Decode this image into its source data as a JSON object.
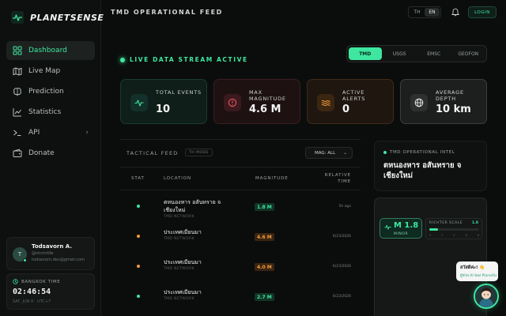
{
  "brand": {
    "name": "PLANETSENSE"
  },
  "sidebar": {
    "items": [
      {
        "label": "Dashboard",
        "icon": "dashboard-icon",
        "active": true
      },
      {
        "label": "Live Map",
        "icon": "map-icon"
      },
      {
        "label": "Prediction",
        "icon": "brain-icon"
      },
      {
        "label": "Statistics",
        "icon": "chart-icon"
      },
      {
        "label": "API",
        "icon": "terminal-icon",
        "has_children": true
      },
      {
        "label": "Donate",
        "icon": "wallet-icon"
      }
    ],
    "user": {
      "initial": "T",
      "name": "Todsavorn A.",
      "handle": "@ntcmrlife",
      "email": "todsavorn.dev@gmail.com"
    },
    "clock": {
      "label": "BANGKOK TIME",
      "time": "02:46:54",
      "date": "SAT, JUN 8 · UTC+7"
    }
  },
  "header": {
    "title": "TMD OPERATIONAL FEED",
    "lang_options": [
      "TH",
      "EN"
    ],
    "lang_selected": "EN",
    "login_label": "LOGIN"
  },
  "status": {
    "live_label": "LIVE DATA STREAM ACTIVE"
  },
  "sources": {
    "tabs": [
      "TMD",
      "USGS",
      "EMSC",
      "GEOFON"
    ],
    "selected": "TMD"
  },
  "stats": [
    {
      "label": "TOTAL EVENTS",
      "value": "10",
      "icon": "pulse-icon",
      "color": "#3ee6a0"
    },
    {
      "label": "MAX MAGNITUDE",
      "value": "4.6 M",
      "icon": "alert-circle-icon",
      "color": "#f0545c"
    },
    {
      "label": "ACTIVE ALERTS",
      "value": "0",
      "icon": "waves-icon",
      "color": "#f59a3c"
    },
    {
      "label": "AVERAGE DEPTH",
      "value": "10 km",
      "icon": "globe-icon",
      "color": "#e6e8e7"
    }
  ],
  "feed": {
    "title": "TACTICAL FEED",
    "badge": "TH MODE",
    "filter_label": "MAG: ALL",
    "columns": {
      "stat": "STAT",
      "location": "LOCATION",
      "magnitude": "MAGNITUDE",
      "relative_time": "RELATIVE TIME"
    },
    "rows": [
      {
        "location": "ตหนองหาร อสันทราย จ เชียงใหม่",
        "network": "TMD NETWORK",
        "magnitude": "1.8 M",
        "time": "5h ago",
        "level": "minor"
      },
      {
        "location": "ประเทศเมียนมา",
        "network": "TMD NETWORK",
        "magnitude": "4.6 M",
        "time": "6/23/2026",
        "level": "strong"
      },
      {
        "location": "ประเทศเมียนมา",
        "network": "TMD NETWORK",
        "magnitude": "4.0 M",
        "time": "6/23/2026",
        "level": "moderate"
      },
      {
        "location": "ประเทศเมียนมา",
        "network": "TMD NETWORK",
        "magnitude": "2.7 M",
        "time": "6/23/2026",
        "level": "minor"
      }
    ]
  },
  "level_colors": {
    "minor": {
      "dot": "#3ee6a0",
      "fg": "#3ee6a0",
      "bg": "#123426"
    },
    "moderate": {
      "dot": "#f59a3c",
      "fg": "#f59a3c",
      "bg": "#3a2510"
    },
    "strong": {
      "dot": "#f59a3c",
      "fg": "#f59a3c",
      "bg": "#3a2510"
    }
  },
  "intel": {
    "label": "TMD OPERATIONAL INTEL",
    "text": "ตหนองหาร อสันทราย จ เชียงใหม่"
  },
  "widget": {
    "magnitude": "M 1.8",
    "class_label": "MINOR",
    "scale_label": "RICHTER SCALE",
    "scale_value": "1.8",
    "scale_fraction": 0.18,
    "ticks": [
      "0",
      "2",
      "4",
      "6",
      "8"
    ]
  },
  "chat": {
    "greeting": "สวัสดีค่ะ! 👋",
    "subtext": "ผู้ช่วย AI ของ PlanetSense"
  }
}
